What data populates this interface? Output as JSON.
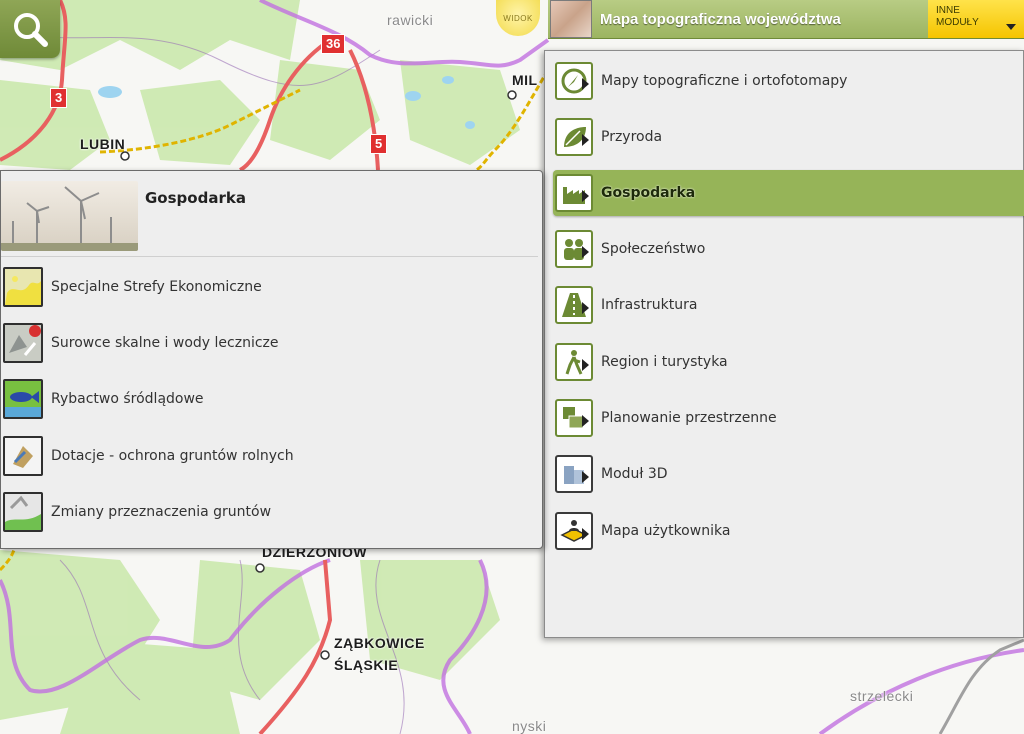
{
  "map": {
    "labels": {
      "rawicki": "rawicki",
      "lubin": "LUBIN",
      "milicz": "MIL",
      "dzierzoniow": "DZIERŻONIÓW",
      "zabkowice": "ZĄBKOWICE",
      "slaskie": "ŚLĄSKIE",
      "strzelecki": "strzelecki",
      "nyski": "nyski"
    },
    "roads": {
      "r36": "36",
      "r3": "3",
      "r5": "5"
    }
  },
  "top": {
    "widok_label": "WIDOK",
    "title": "Mapa topograficzna województwa",
    "other_modules_line1": "INNE",
    "other_modules_line2": "MODUŁY"
  },
  "module_menu": {
    "items": [
      {
        "label": "Mapy topograficzne i ortofotomapy",
        "icon": "compass-map-icon"
      },
      {
        "label": "Przyroda",
        "icon": "leaf-icon"
      },
      {
        "label": "Gospodarka",
        "icon": "factory-icon",
        "active": true
      },
      {
        "label": "Społeczeństwo",
        "icon": "people-icon"
      },
      {
        "label": "Infrastruktura",
        "icon": "road-icon"
      },
      {
        "label": "Region i turystyka",
        "icon": "hiker-icon"
      },
      {
        "label": "Planowanie przestrzenne",
        "icon": "planning-icon"
      },
      {
        "label": "Moduł 3D",
        "icon": "3d-blocks-icon"
      },
      {
        "label": "Mapa użytkownika",
        "icon": "user-layers-icon"
      }
    ]
  },
  "sub_panel": {
    "title": "Gospodarka",
    "items": [
      {
        "label": "Specjalne Strefy Ekonomiczne",
        "icon": "sse-map-icon"
      },
      {
        "label": "Surowce skalne i wody lecznicze",
        "icon": "rocks-map-icon"
      },
      {
        "label": "Rybactwo śródlądowe",
        "icon": "fish-icon"
      },
      {
        "label": "Dotacje - ochrona gruntów rolnych",
        "icon": "subsidy-icon"
      },
      {
        "label": "Zmiany przeznaczenia gruntów",
        "icon": "land-change-icon"
      }
    ]
  },
  "colors": {
    "accent_green": "#96b458",
    "accent_yellow": "#f5c400",
    "road_red": "#e03030"
  }
}
